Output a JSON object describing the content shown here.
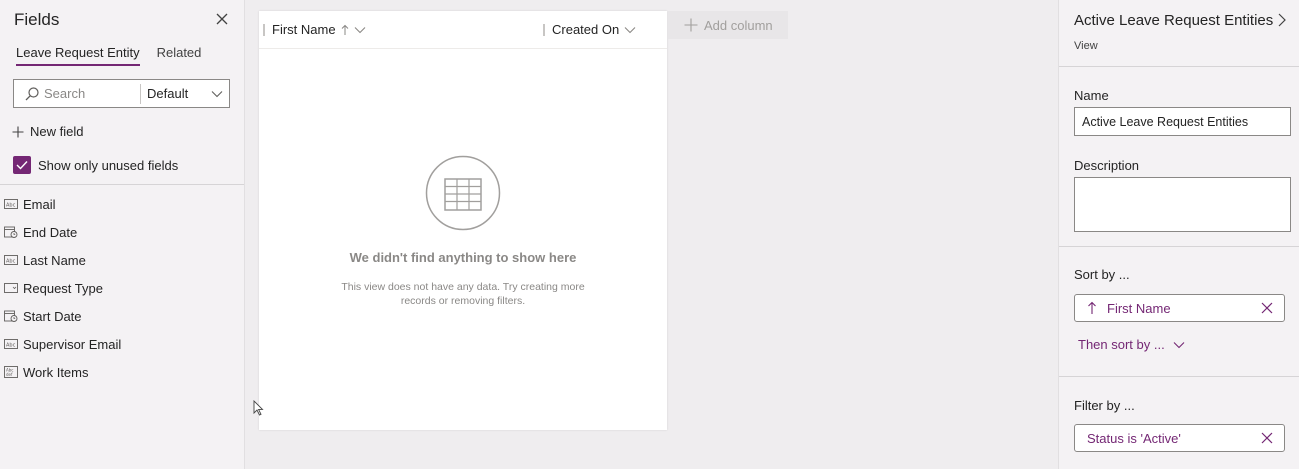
{
  "fields_panel": {
    "title": "Fields",
    "tabs": [
      {
        "label": "Leave Request Entity",
        "active": true
      },
      {
        "label": "Related",
        "active": false
      }
    ],
    "search_placeholder": "Search",
    "filter_select": "Default",
    "new_field_label": "New field",
    "show_unused_label": "Show only unused fields",
    "show_unused_checked": true,
    "items": [
      {
        "label": "Email",
        "icon": "text-field-icon"
      },
      {
        "label": "End Date",
        "icon": "date-field-icon"
      },
      {
        "label": "Last Name",
        "icon": "text-field-icon"
      },
      {
        "label": "Request Type",
        "icon": "choice-field-icon"
      },
      {
        "label": "Start Date",
        "icon": "date-field-icon"
      },
      {
        "label": "Supervisor Email",
        "icon": "text-field-icon"
      },
      {
        "label": "Work Items",
        "icon": "multiline-text-field-icon"
      }
    ]
  },
  "grid": {
    "columns": [
      {
        "label": "First Name",
        "sorted": "ascending"
      },
      {
        "label": "Created On",
        "sorted": null
      }
    ],
    "add_column_label": "Add column",
    "empty_title": "We didn't find anything to show here",
    "empty_description_line1": "This view does not have any data. Try creating more",
    "empty_description_line2": "records or removing filters."
  },
  "view_panel": {
    "title": "Active Leave Request Entities",
    "subtitle": "View",
    "name_label": "Name",
    "name_value": "Active Leave Request Entities",
    "description_label": "Description",
    "description_value": "",
    "sort_label": "Sort by ...",
    "sort_value": "First Name",
    "then_sort_label": "Then sort by ...",
    "filter_label": "Filter by ...",
    "filter_value": "Status is 'Active'"
  },
  "colors": {
    "accent": "#742774",
    "panel_bg": "#f4f2f4",
    "canvas_bg": "#efedef"
  }
}
